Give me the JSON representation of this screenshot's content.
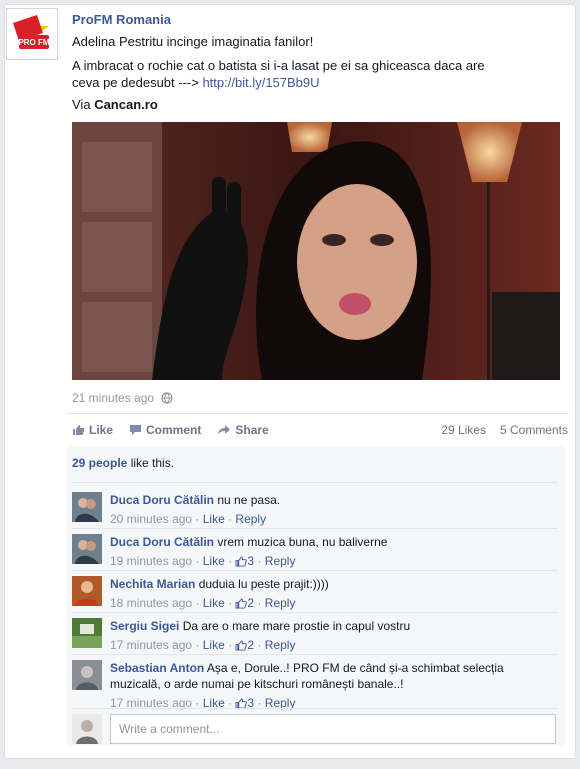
{
  "page": {
    "name": "ProFM Romania",
    "avatar_text": "PRO FM"
  },
  "post": {
    "line1": "Adelina Pestritu incinge imaginatia fanilor!",
    "line2_text": "A imbracat o rochie cat o batista si i-a lasat pe ei sa ghiceasca daca are ceva pe dedesubt --->",
    "link": "http://bit.ly/157Bb9U",
    "via_prefix": "Via",
    "via_source": "Cancan.ro",
    "timestamp": "21 minutes ago"
  },
  "actions": {
    "like": "Like",
    "comment": "Comment",
    "share": "Share",
    "likes_count": "29 Likes",
    "comments_count": "5 Comments"
  },
  "likes_summary": {
    "people": "29 people",
    "suffix": "like this."
  },
  "comments": [
    {
      "author": "Duca Doru Cătălin",
      "text": "nu ne pasa.",
      "time": "20 minutes ago",
      "like": "Like",
      "likes": "",
      "reply": "Reply"
    },
    {
      "author": "Duca Doru Cătălin",
      "text": "vrem muzica buna, nu baliverne",
      "time": "19 minutes ago",
      "like": "Like",
      "likes": "3",
      "reply": "Reply"
    },
    {
      "author": "Nechita Marian",
      "text": "duduia lu peste prajit:))))",
      "time": "18 minutes ago",
      "like": "Like",
      "likes": "2",
      "reply": "Reply"
    },
    {
      "author": "Sergiu Sigei",
      "text": "Da are o mare mare prostie in capul vostru",
      "time": "17 minutes ago",
      "like": "Like",
      "likes": "2",
      "reply": "Reply"
    },
    {
      "author": "Sebastian Anton",
      "text": "Așa e, Dorule..! PRO FM de când și-a schimbat selecția muzicală, o arde numai pe kitschuri românești banale..!",
      "time": "17 minutes ago",
      "like": "Like",
      "likes": "3",
      "reply": "Reply"
    }
  ],
  "composer": {
    "placeholder": "Write a comment..."
  },
  "colors": {
    "link_blue": "#3b5998",
    "meta_gray": "#9197a3",
    "brand_red": "#d8202b",
    "brand_yellow": "#f5c400"
  }
}
